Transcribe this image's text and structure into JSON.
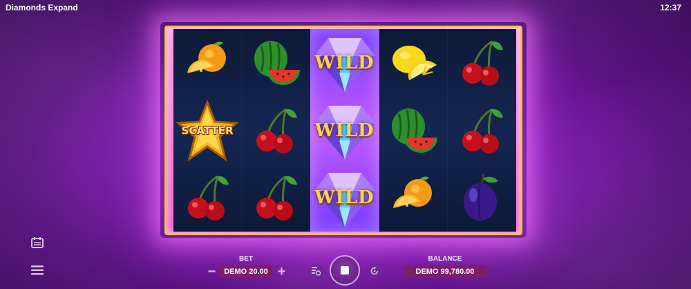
{
  "app": {
    "title": "Diamonds Expand",
    "clock": "12:37"
  },
  "reels": [
    [
      "orange",
      "scatter",
      "cherry"
    ],
    [
      "watermelon",
      "cherry",
      "cherry"
    ],
    [
      "wild",
      "wild",
      "wild"
    ],
    [
      "lemon",
      "watermelon",
      "orange"
    ],
    [
      "cherry",
      "cherry",
      "plum"
    ]
  ],
  "symbol_text": {
    "wild": "WILD",
    "scatter": "SCATTER"
  },
  "footer": {
    "bet_label": "BET",
    "bet_value": "DEMO 20.00",
    "balance_label": "BALANCE",
    "balance_value": "DEMO 99,780.00",
    "minus": "−",
    "plus": "+"
  },
  "icons": {
    "side": [
      "paytable-icon",
      "menu-icon"
    ],
    "controls": [
      "autoplay-icon",
      "stop-icon",
      "turbo-icon"
    ]
  },
  "colors": {
    "frame": "#f7c23a",
    "background": "#8d1fc0",
    "wild_reel": "#c05bff",
    "pill": "#7b1f6a"
  }
}
